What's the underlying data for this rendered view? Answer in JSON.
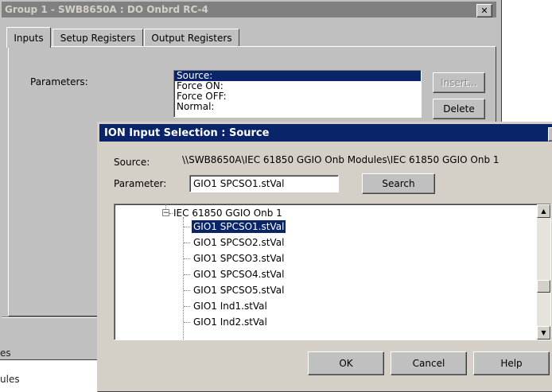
{
  "background_window": {
    "title": "Group 1 - SWB8650A : DO Onbrd RC-4",
    "close_glyph": "✕",
    "tabs": [
      {
        "label": "Inputs"
      },
      {
        "label": "Setup Registers"
      },
      {
        "label": "Output Registers"
      }
    ],
    "parameters_label": "Parameters:",
    "parameters_list": [
      "Source:",
      "Force ON:",
      "Force OFF:",
      "Normal:"
    ],
    "buttons": {
      "insert": "Insert...",
      "delete": "Delete"
    },
    "side_text": [
      "es",
      "ules"
    ]
  },
  "dialog": {
    "title": "ION Input Selection : Source",
    "close_glyph": "✕",
    "source_label": "Source:",
    "source_value": "\\\\SWB8650A\\IEC 61850 GGIO Onb Modules\\IEC 61850 GGIO Onb 1",
    "parameter_label": "Parameter:",
    "parameter_value": "GIO1 SPCSO1.stVal",
    "search_button": "Search",
    "tree": {
      "parent": "IEC 61850 GGIO Onb 1",
      "expander_glyph": "−",
      "items": [
        "GIO1 SPCSO1.stVal",
        "GIO1 SPCSO2.stVal",
        "GIO1 SPCSO3.stVal",
        "GIO1 SPCSO4.stVal",
        "GIO1 SPCSO5.stVal",
        "GIO1 Ind1.stVal",
        "GIO1 Ind2.stVal"
      ],
      "selected_index": 0
    },
    "scroll_up_glyph": "▲",
    "scroll_down_glyph": "▼",
    "buttons": {
      "ok": "OK",
      "cancel": "Cancel",
      "help": "Help"
    }
  },
  "colors": {
    "selection": "#0a246a",
    "face": "#d4d0c8",
    "inactive_title": "#808080"
  }
}
